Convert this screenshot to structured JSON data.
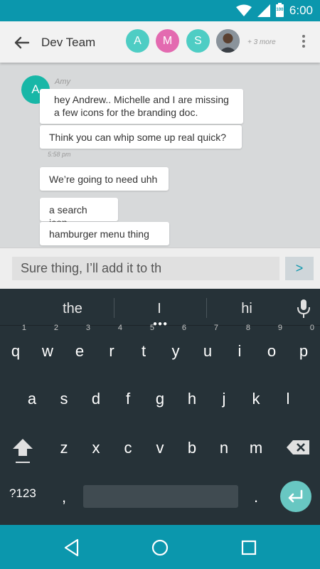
{
  "status_bar": {
    "time": "6:00",
    "battery_level": "100"
  },
  "app_bar": {
    "title": "Dev Team",
    "participants": [
      "A",
      "M",
      "S"
    ],
    "more_label": "+ 3 more"
  },
  "chat": {
    "sender_initial": "A",
    "sender_name": "Amy",
    "messages": [
      "hey Andrew.. Michelle and I are missing a few icons for the branding doc.",
      "Think you can whip some up real quick?",
      "We’re going to need uhh",
      "a search icon,",
      "hamburger menu thing"
    ],
    "timestamp": "5:58 pm"
  },
  "composer": {
    "value": "Sure thing, I’ll add it to th",
    "send_label": ">"
  },
  "keyboard": {
    "suggestions": [
      "the",
      "I",
      "hi"
    ],
    "row1": [
      "q",
      "w",
      "e",
      "r",
      "t",
      "y",
      "u",
      "i",
      "o",
      "p"
    ],
    "row1_hints": [
      "1",
      "2",
      "3",
      "4",
      "5",
      "6",
      "7",
      "8",
      "9",
      "0"
    ],
    "row2": [
      "a",
      "s",
      "d",
      "f",
      "g",
      "h",
      "j",
      "k",
      "l"
    ],
    "row3": [
      "z",
      "x",
      "c",
      "v",
      "b",
      "n",
      "m"
    ],
    "symbols_label": "?123",
    "comma": ",",
    "period": "."
  },
  "colors": {
    "primary": "#0b97ad",
    "accent": "#4ecdc4",
    "keyboard_bg": "#263238"
  },
  "icons": [
    "back-arrow-icon",
    "overflow-menu-icon",
    "wifi-icon",
    "signal-icon",
    "battery-icon",
    "mic-icon",
    "shift-icon",
    "backspace-icon",
    "enter-icon",
    "nav-back-icon",
    "nav-home-icon",
    "nav-recents-icon"
  ]
}
